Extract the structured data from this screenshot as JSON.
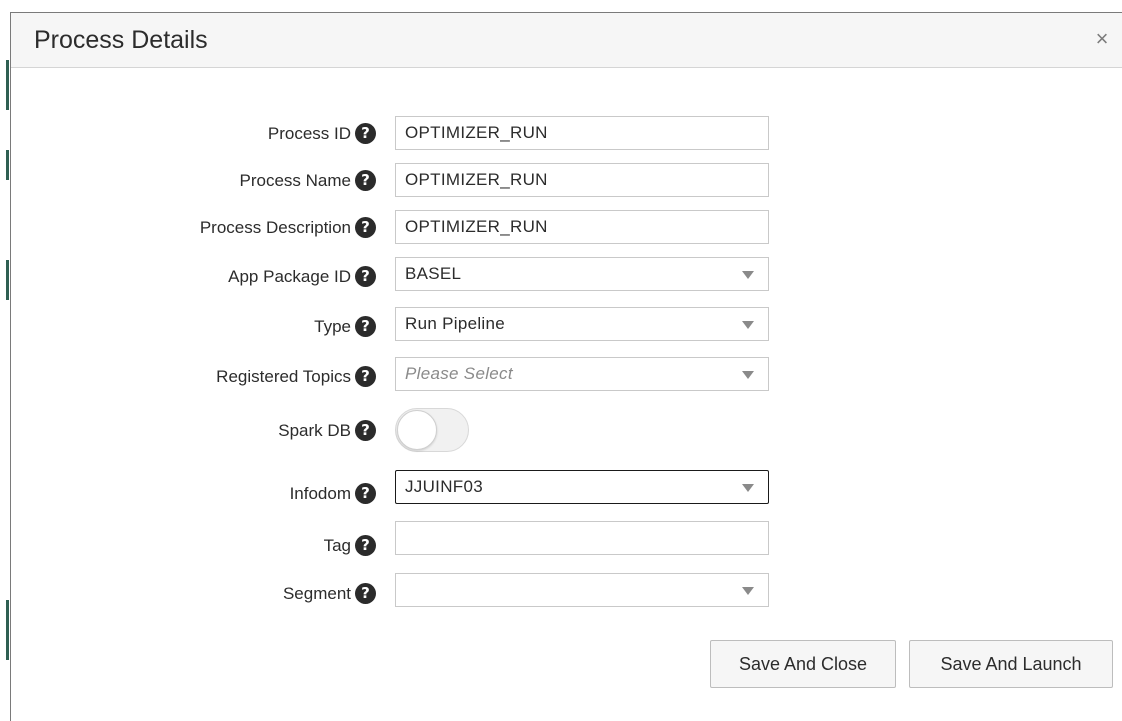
{
  "dialog": {
    "title": "Process Details",
    "close_label": "×"
  },
  "form": {
    "process_id": {
      "label": "Process ID",
      "value": "OPTIMIZER_RUN"
    },
    "process_name": {
      "label": "Process Name",
      "value": "OPTIMIZER_RUN"
    },
    "process_description": {
      "label": "Process Description",
      "value": "OPTIMIZER_RUN"
    },
    "app_package_id": {
      "label": "App Package ID",
      "value": "BASEL"
    },
    "type": {
      "label": "Type",
      "value": "Run Pipeline"
    },
    "registered_topics": {
      "label": "Registered Topics",
      "placeholder": "Please Select"
    },
    "spark_db": {
      "label": "Spark DB",
      "enabled": false
    },
    "infodom": {
      "label": "Infodom",
      "value": "JJUINF03"
    },
    "tag": {
      "label": "Tag",
      "value": ""
    },
    "segment": {
      "label": "Segment",
      "value": ""
    },
    "help_glyph": "?"
  },
  "buttons": {
    "save_and_close": "Save And Close",
    "save_and_launch": "Save And Launch"
  },
  "icons": {
    "help": "question-circle-icon",
    "close": "close-icon",
    "dropdown": "chevron-down-icon"
  },
  "colors": {
    "header_bg": "#f6f6f6",
    "help_icon_bg": "#2b2b2b",
    "focused_border": "#1a1a1a",
    "field_border": "#c9c9c9"
  }
}
